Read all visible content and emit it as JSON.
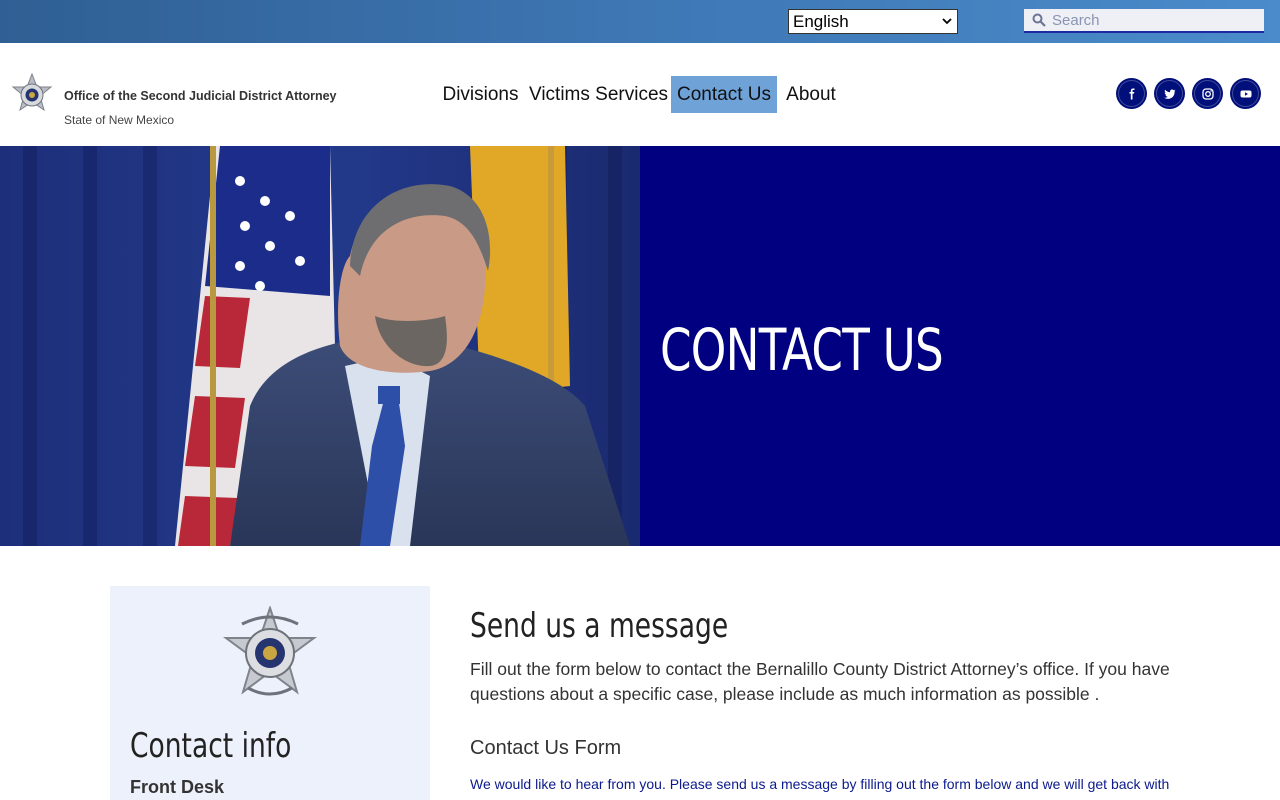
{
  "topbar": {
    "language_selected": "English",
    "search_placeholder": "Search"
  },
  "header": {
    "org_name": "Office of the Second Judicial District Attorney",
    "org_subtitle": "State of New Mexico",
    "nav": [
      {
        "label": "Divisions",
        "active": false
      },
      {
        "label": "Victims Services",
        "active": false
      },
      {
        "label": "Contact Us",
        "active": true
      },
      {
        "label": "About",
        "active": false
      }
    ],
    "social_icons": [
      "facebook-icon",
      "twitter-icon",
      "instagram-icon",
      "youtube-icon"
    ]
  },
  "hero": {
    "title": "CONTACT US"
  },
  "sidebar": {
    "title": "Contact info",
    "subtitle": "Front Desk"
  },
  "main": {
    "title": "Send us a message",
    "intro": "Fill out the form below to contact the Bernalillo County District Attorney’s office. If you have questions about a specific case, please include as much information as possible .",
    "form_title": "Contact Us Form",
    "form_description": "We would like to hear from you. Please send us a message by filling out the form below and we will get back with"
  },
  "colors": {
    "topbar": "#3e77b4",
    "nav_active": "#6fa3d8",
    "hero_panel": "#000080",
    "social_bg": "#000f7a",
    "card_bg": "#edf1fb"
  }
}
